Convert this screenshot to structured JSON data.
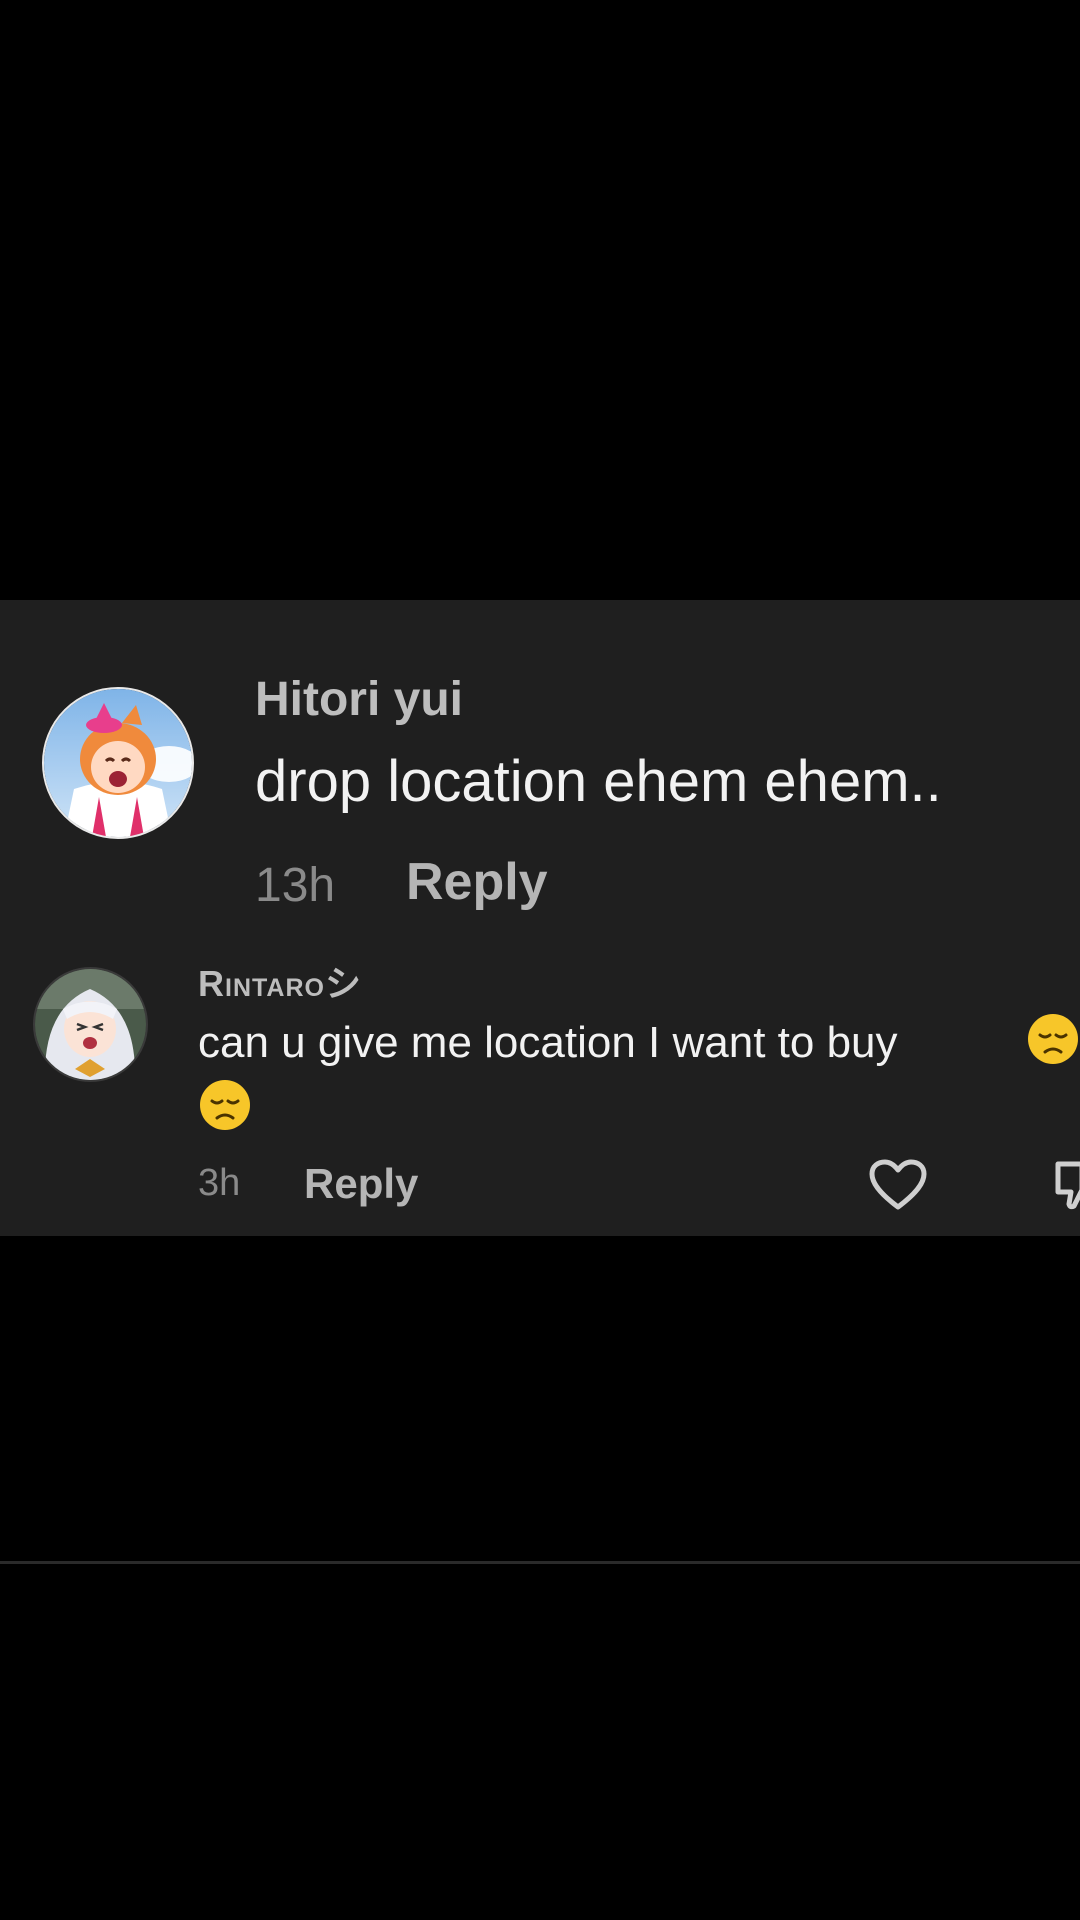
{
  "comments": [
    {
      "username": "Hitori yui",
      "text": "drop location ehem ehem..",
      "time": "13h",
      "reply_label": "Reply"
    },
    {
      "username": "Rintaroシ",
      "text": "can u give me location I want to buy",
      "time": "3h",
      "reply_label": "Reply",
      "emoji": "disappointed-face",
      "actions": [
        "heart-icon",
        "thumbs-down-icon"
      ]
    }
  ],
  "colors": {
    "page_background": "#000000",
    "panel_background": "#1f1f1f",
    "text_primary": "#f2f2f2",
    "text_secondary": "#bdbdbd",
    "text_muted": "#8a8a8a"
  }
}
